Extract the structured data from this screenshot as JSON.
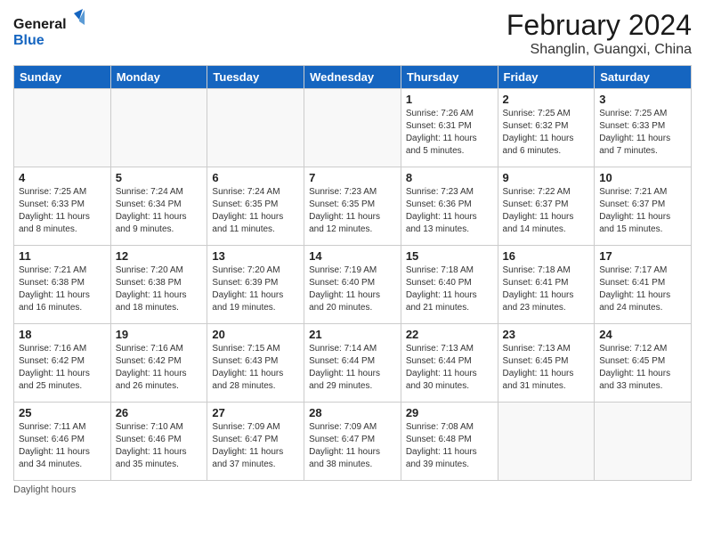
{
  "logo": {
    "line1": "General",
    "line2": "Blue"
  },
  "title": "February 2024",
  "subtitle": "Shanglin, Guangxi, China",
  "days_of_week": [
    "Sunday",
    "Monday",
    "Tuesday",
    "Wednesday",
    "Thursday",
    "Friday",
    "Saturday"
  ],
  "footer": {
    "daylight_note": "Daylight hours"
  },
  "weeks": [
    [
      {
        "day": "",
        "info": ""
      },
      {
        "day": "",
        "info": ""
      },
      {
        "day": "",
        "info": ""
      },
      {
        "day": "",
        "info": ""
      },
      {
        "day": "1",
        "sunrise": "7:26 AM",
        "sunset": "6:31 PM",
        "daylight": "11 hours and 5 minutes."
      },
      {
        "day": "2",
        "sunrise": "7:25 AM",
        "sunset": "6:32 PM",
        "daylight": "11 hours and 6 minutes."
      },
      {
        "day": "3",
        "sunrise": "7:25 AM",
        "sunset": "6:33 PM",
        "daylight": "11 hours and 7 minutes."
      }
    ],
    [
      {
        "day": "4",
        "sunrise": "7:25 AM",
        "sunset": "6:33 PM",
        "daylight": "11 hours and 8 minutes."
      },
      {
        "day": "5",
        "sunrise": "7:24 AM",
        "sunset": "6:34 PM",
        "daylight": "11 hours and 9 minutes."
      },
      {
        "day": "6",
        "sunrise": "7:24 AM",
        "sunset": "6:35 PM",
        "daylight": "11 hours and 11 minutes."
      },
      {
        "day": "7",
        "sunrise": "7:23 AM",
        "sunset": "6:35 PM",
        "daylight": "11 hours and 12 minutes."
      },
      {
        "day": "8",
        "sunrise": "7:23 AM",
        "sunset": "6:36 PM",
        "daylight": "11 hours and 13 minutes."
      },
      {
        "day": "9",
        "sunrise": "7:22 AM",
        "sunset": "6:37 PM",
        "daylight": "11 hours and 14 minutes."
      },
      {
        "day": "10",
        "sunrise": "7:21 AM",
        "sunset": "6:37 PM",
        "daylight": "11 hours and 15 minutes."
      }
    ],
    [
      {
        "day": "11",
        "sunrise": "7:21 AM",
        "sunset": "6:38 PM",
        "daylight": "11 hours and 16 minutes."
      },
      {
        "day": "12",
        "sunrise": "7:20 AM",
        "sunset": "6:38 PM",
        "daylight": "11 hours and 18 minutes."
      },
      {
        "day": "13",
        "sunrise": "7:20 AM",
        "sunset": "6:39 PM",
        "daylight": "11 hours and 19 minutes."
      },
      {
        "day": "14",
        "sunrise": "7:19 AM",
        "sunset": "6:40 PM",
        "daylight": "11 hours and 20 minutes."
      },
      {
        "day": "15",
        "sunrise": "7:18 AM",
        "sunset": "6:40 PM",
        "daylight": "11 hours and 21 minutes."
      },
      {
        "day": "16",
        "sunrise": "7:18 AM",
        "sunset": "6:41 PM",
        "daylight": "11 hours and 23 minutes."
      },
      {
        "day": "17",
        "sunrise": "7:17 AM",
        "sunset": "6:41 PM",
        "daylight": "11 hours and 24 minutes."
      }
    ],
    [
      {
        "day": "18",
        "sunrise": "7:16 AM",
        "sunset": "6:42 PM",
        "daylight": "11 hours and 25 minutes."
      },
      {
        "day": "19",
        "sunrise": "7:16 AM",
        "sunset": "6:42 PM",
        "daylight": "11 hours and 26 minutes."
      },
      {
        "day": "20",
        "sunrise": "7:15 AM",
        "sunset": "6:43 PM",
        "daylight": "11 hours and 28 minutes."
      },
      {
        "day": "21",
        "sunrise": "7:14 AM",
        "sunset": "6:44 PM",
        "daylight": "11 hours and 29 minutes."
      },
      {
        "day": "22",
        "sunrise": "7:13 AM",
        "sunset": "6:44 PM",
        "daylight": "11 hours and 30 minutes."
      },
      {
        "day": "23",
        "sunrise": "7:13 AM",
        "sunset": "6:45 PM",
        "daylight": "11 hours and 31 minutes."
      },
      {
        "day": "24",
        "sunrise": "7:12 AM",
        "sunset": "6:45 PM",
        "daylight": "11 hours and 33 minutes."
      }
    ],
    [
      {
        "day": "25",
        "sunrise": "7:11 AM",
        "sunset": "6:46 PM",
        "daylight": "11 hours and 34 minutes."
      },
      {
        "day": "26",
        "sunrise": "7:10 AM",
        "sunset": "6:46 PM",
        "daylight": "11 hours and 35 minutes."
      },
      {
        "day": "27",
        "sunrise": "7:09 AM",
        "sunset": "6:47 PM",
        "daylight": "11 hours and 37 minutes."
      },
      {
        "day": "28",
        "sunrise": "7:09 AM",
        "sunset": "6:47 PM",
        "daylight": "11 hours and 38 minutes."
      },
      {
        "day": "29",
        "sunrise": "7:08 AM",
        "sunset": "6:48 PM",
        "daylight": "11 hours and 39 minutes."
      },
      {
        "day": "",
        "info": ""
      },
      {
        "day": "",
        "info": ""
      }
    ]
  ]
}
